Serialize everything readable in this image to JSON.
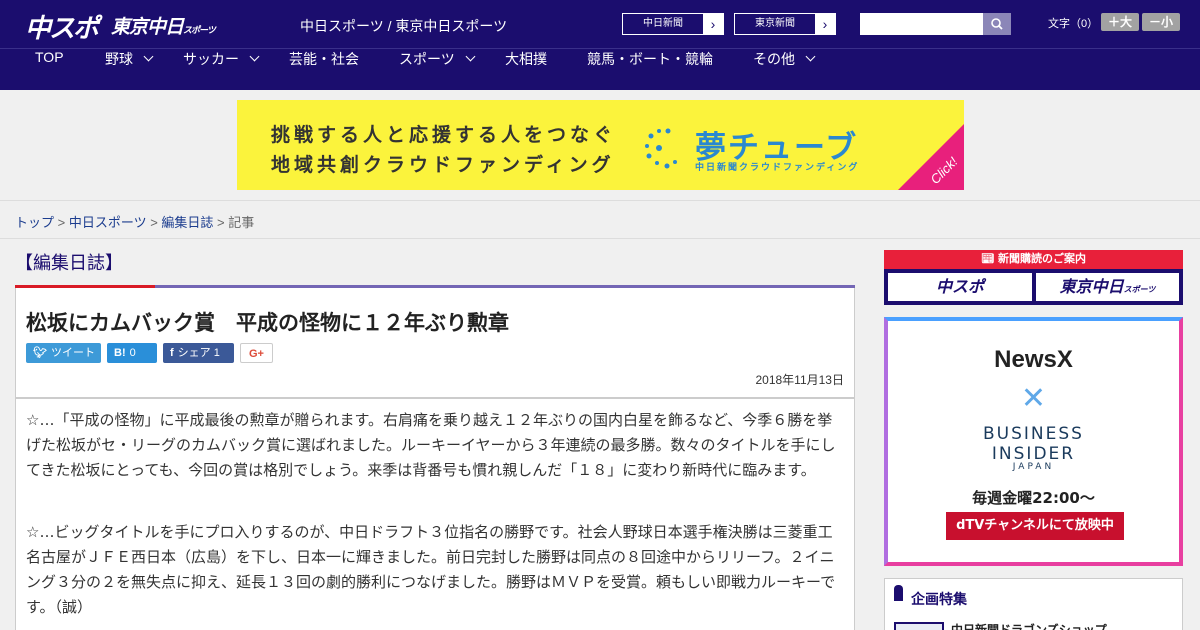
{
  "header": {
    "logo_chuspo": "中スポ",
    "logo_tokyo": "東京中日",
    "logo_tokyo_small": "スポーツ",
    "tagline": "中日スポーツ / 東京中日スポーツ",
    "paper_buttons": [
      {
        "label": "中日新聞",
        "arrow": "›"
      },
      {
        "label": "東京新聞",
        "arrow": "›"
      }
    ],
    "search_placeholder": "",
    "fontsize_label": "文字（0）",
    "fontsize_plus": "＋大",
    "fontsize_minus": "－小"
  },
  "nav": {
    "items": [
      {
        "label": "TOP",
        "dropdown": false
      },
      {
        "label": "野球",
        "dropdown": true
      },
      {
        "label": "サッカー",
        "dropdown": true
      },
      {
        "label": "芸能・社会",
        "dropdown": false
      },
      {
        "label": "スポーツ",
        "dropdown": true
      },
      {
        "label": "大相撲",
        "dropdown": false
      },
      {
        "label": "競馬・ボート・競輪",
        "dropdown": false
      },
      {
        "label": "その他",
        "dropdown": true
      }
    ]
  },
  "banner": {
    "line1": "挑戦する人と応援する人をつなぐ",
    "line2": "地域共創クラウドファンディング",
    "brand": "夢チューブ",
    "brand_sub": "中日新聞クラウドファンディング",
    "click": "Click!",
    "colors": {
      "bg": "#fbf33c",
      "brand": "#2a88d0",
      "corner": "#e8207c"
    }
  },
  "breadcrumb": {
    "items": [
      "トップ",
      "中日スポーツ",
      "編集日誌"
    ],
    "separator": " > ",
    "current": "記事"
  },
  "article": {
    "section": "【編集日誌】",
    "headline": "松坂にカムバック賞　平成の怪物に１２年ぶり勲章",
    "share": {
      "tweet": "ツイート",
      "hatena_label": "B!",
      "hatena_count": "0",
      "facebook_label": "シェア",
      "facebook_count": "1",
      "gplus": "G+"
    },
    "date": "2018年11月13日",
    "paragraphs": [
      "☆…「平成の怪物」に平成最後の勲章が贈られます。右肩痛を乗り越え１２年ぶりの国内白星を飾るなど、今季６勝を挙げた松坂がセ・リーグのカムバック賞に選ばれました。ルーキーイヤーから３年連続の最多勝。数々のタイトルを手にしてきた松坂にとっても、今回の賞は格別でしょう。来季は背番号も慣れ親しんだ「１８」に変わり新時代に臨みます。",
      "☆…ビッグタイトルを手にプロ入りするのが、中日ドラフト３位指名の勝野です。社会人野球日本選手権決勝は三菱重工名古屋がＪＦＥ西日本（広島）を下し、日本一に輝きました。前日完封した勝野は同点の８回途中からリリーフ。２イニング３分の２を無失点に抑え、延長１３回の劇的勝利につなげました。勝野はＭＶＰを受賞。頼もしい即戦力ルーキーです。（誠）"
    ]
  },
  "sidebar": {
    "subscription": {
      "heading": "新聞購読のご案内",
      "buttons": [
        "中スポ",
        "東京中日"
      ],
      "button_small": "スポーツ"
    },
    "ad": {
      "newsx": "NewsX",
      "x_mark": "✕",
      "business": "BUSINESS",
      "insider": "INSIDER",
      "japan": "JAPAN",
      "schedule": "毎週金曜22:00〜",
      "dtv": "dTVチャンネルにて放映中"
    },
    "featured": {
      "title": "企画特集",
      "item": "中日新聞ドラゴンズショップ"
    }
  }
}
